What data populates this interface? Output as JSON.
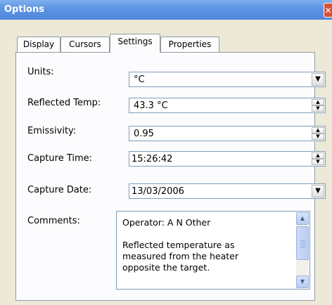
{
  "window": {
    "title": "Options",
    "close_glyph": "✕"
  },
  "tabs": [
    {
      "label": "Display",
      "active": false
    },
    {
      "label": "Cursors",
      "active": false
    },
    {
      "label": "Settings",
      "active": true
    },
    {
      "label": "Properties",
      "active": false
    }
  ],
  "settings": {
    "units": {
      "label": "Units:",
      "value": "°C"
    },
    "reflected_temp": {
      "label": "Reflected Temp:",
      "value": "43.3 °C"
    },
    "emissivity": {
      "label": "Emissivity:",
      "value": "0.95"
    },
    "capture_time": {
      "label": "Capture Time:",
      "value": "15:26:42"
    },
    "capture_date": {
      "label": "Capture Date:",
      "value": "13/03/2006"
    },
    "comments": {
      "label": "Comments:",
      "value": "Operator: A N Other\n\nReflected temperature as\nmeasured from the heater\nopposite the target."
    }
  },
  "glyphs": {
    "dropdown": "▼",
    "spin_up": "▲",
    "spin_down": "▼",
    "scroll_up": "▲",
    "scroll_down": "▼"
  },
  "colors": {
    "titlebar": "#5f95e3",
    "window_bg": "#ece9d8",
    "field_border": "#7f9db9",
    "close_button": "#d8503a"
  }
}
